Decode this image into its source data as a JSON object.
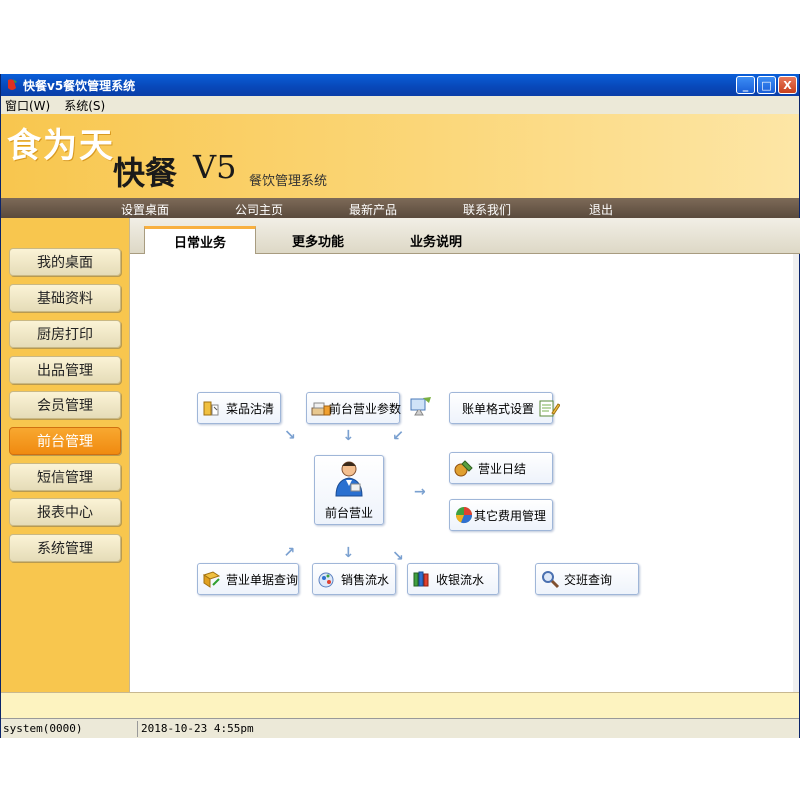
{
  "window": {
    "title": "快餐v5餐饮管理系统",
    "btn_min": "_",
    "btn_max": "□",
    "btn_close": "X"
  },
  "menu": [
    "窗口(W)",
    "系统(S)"
  ],
  "banner": {
    "slogan": "食为天",
    "brand": "快餐",
    "version": "V5",
    "subtitle": "餐饮管理系统"
  },
  "topnav": [
    "设置桌面",
    "公司主页",
    "最新产品",
    "联系我们",
    "退出"
  ],
  "sidebar": [
    "我的桌面",
    "基础资料",
    "厨房打印",
    "出品管理",
    "会员管理",
    "前台管理",
    "短信管理",
    "报表中心",
    "系统管理"
  ],
  "sidebar_active": "前台管理",
  "tabs": [
    "日常业务",
    "更多功能",
    "业务说明"
  ],
  "tab_active": "日常业务",
  "flow": {
    "center": "前台营业",
    "top": [
      "菜品沽清",
      "前台营业参数",
      "账单格式设置"
    ],
    "right": [
      "营业日结",
      "其它费用管理"
    ],
    "bottom": [
      "营业单据查询",
      "销售流水",
      "收银流水",
      "交班查询"
    ]
  },
  "status": {
    "user": "system(0000)",
    "datetime": "2018-10-23 4:55pm"
  }
}
